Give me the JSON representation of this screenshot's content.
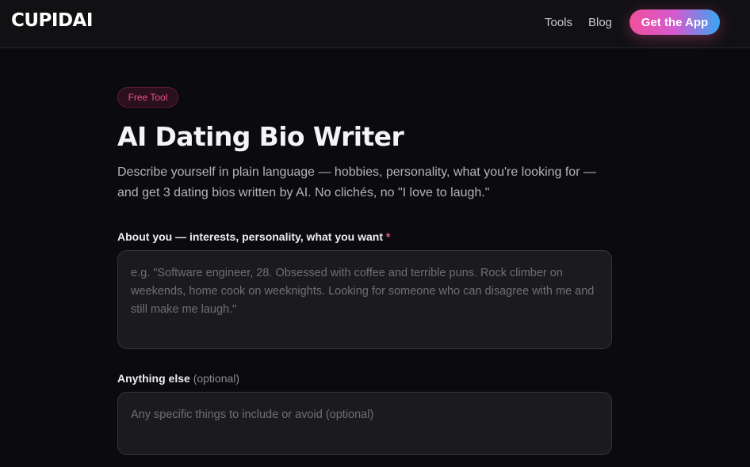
{
  "nav": {
    "logo": "CUPIDAI",
    "links": [
      "Tools",
      "Blog"
    ],
    "cta_label": "Get the App"
  },
  "hero": {
    "badge": "Free Tool",
    "title": "AI Dating Bio Writer",
    "subtitle": "Describe yourself in plain language — hobbies, personality, what you're looking for — and get 3 dating bios written by AI. No clichés, no \"I love to laugh.\""
  },
  "form": {
    "about": {
      "label": "About you — interests, personality, what you want",
      "required_mark": "*",
      "value": "",
      "placeholder": "e.g. \"Software engineer, 28. Obsessed with coffee and terrible puns. Rock climber on weekends, home cook on weeknights. Looking for someone who can disagree with me and still make me laugh.\""
    },
    "extra": {
      "label": "Anything else",
      "optional_note": "(optional)",
      "value": "",
      "placeholder": "Any specific things to include or avoid (optional)"
    }
  },
  "colors": {
    "background": "#0b0b0d",
    "accent_pink": "#f0509c",
    "accent_blue": "#39a6f2",
    "field_bg": "#1b1b1f"
  }
}
